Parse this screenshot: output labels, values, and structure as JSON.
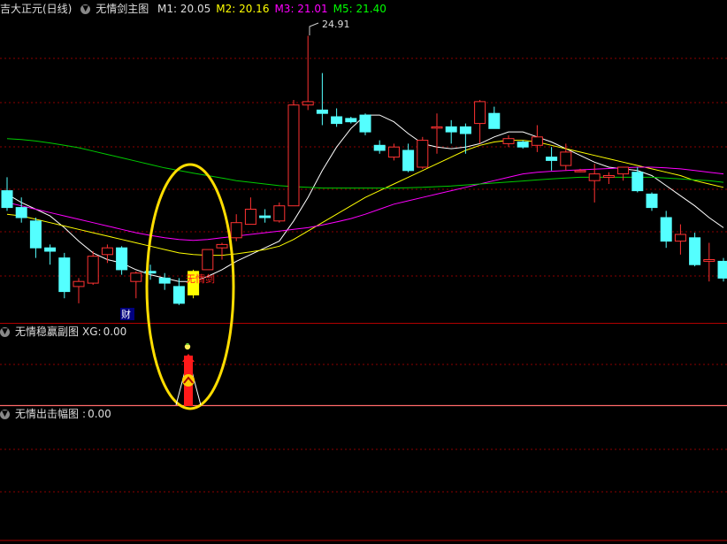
{
  "main_panel": {
    "stock_name": "吉大正元(日线)",
    "indicator_name": "无情剑主图",
    "indicators": [
      {
        "label": "M1:",
        "value": "20.05",
        "color": "#ffffff"
      },
      {
        "label": "M2:",
        "value": "20.16",
        "color": "#ffff00"
      },
      {
        "label": "M3:",
        "value": "21.01",
        "color": "#ff00ff"
      },
      {
        "label": "M5:",
        "value": "21.40",
        "color": "#00ff00"
      }
    ],
    "high_marker": "24.91",
    "signal_label": "无情剑",
    "badge": "财"
  },
  "sub_panel_1": {
    "name": "无情稳赢副图",
    "label": "XG:",
    "value": "0.00"
  },
  "sub_panel_2": {
    "name": "无情出击幅图",
    "label": ":",
    "value": "0.00"
  },
  "icons": [
    "collapse-triangle-icon",
    "up-chevron-signal-icon",
    "bell-icon"
  ],
  "colors": {
    "up_candle": "#ff3232",
    "down_candle": "#54ffff",
    "signal_candle": "#ffff00",
    "ma_m1": "#ffffff",
    "ma_m2": "#ffff00",
    "ma_m3": "#ff00ff",
    "ma_m5": "#00cc00",
    "highlight_ellipse": "#ffdd00",
    "grid": "#8b0000"
  },
  "chart_data": {
    "type": "candlestick",
    "candles": [
      {
        "o": 20.3,
        "h": 20.7,
        "l": 19.7,
        "c": 19.8
      },
      {
        "o": 19.8,
        "h": 20.1,
        "l": 19.35,
        "c": 19.5
      },
      {
        "o": 19.4,
        "h": 19.5,
        "l": 18.3,
        "c": 18.6
      },
      {
        "o": 18.6,
        "h": 18.7,
        "l": 18.1,
        "c": 18.5
      },
      {
        "o": 18.3,
        "h": 18.45,
        "l": 17.1,
        "c": 17.3
      },
      {
        "o": 17.45,
        "h": 17.7,
        "l": 16.95,
        "c": 17.6
      },
      {
        "o": 17.55,
        "h": 18.5,
        "l": 17.5,
        "c": 18.35
      },
      {
        "o": 18.4,
        "h": 18.7,
        "l": 18.15,
        "c": 18.6
      },
      {
        "o": 18.6,
        "h": 18.65,
        "l": 17.8,
        "c": 17.95
      },
      {
        "o": 17.6,
        "h": 17.9,
        "l": 17.1,
        "c": 17.85
      },
      {
        "o": 17.9,
        "h": 18.1,
        "l": 17.65,
        "c": 17.85
      },
      {
        "o": 17.7,
        "h": 17.85,
        "l": 17.35,
        "c": 17.55
      },
      {
        "o": 17.45,
        "h": 17.7,
        "l": 16.9,
        "c": 16.95
      },
      {
        "o": 17.2,
        "h": 17.95,
        "l": 17.1,
        "c": 17.9,
        "signal": true
      },
      {
        "o": 17.95,
        "h": 18.55,
        "l": 17.95,
        "c": 18.55
      },
      {
        "o": 18.6,
        "h": 18.75,
        "l": 18.25,
        "c": 18.7
      },
      {
        "o": 18.9,
        "h": 19.6,
        "l": 18.8,
        "c": 19.35
      },
      {
        "o": 19.3,
        "h": 20.1,
        "l": 19.3,
        "c": 19.75
      },
      {
        "o": 19.55,
        "h": 19.75,
        "l": 19.35,
        "c": 19.5
      },
      {
        "o": 19.4,
        "h": 19.95,
        "l": 19.35,
        "c": 19.85
      },
      {
        "o": 19.85,
        "h": 23.0,
        "l": 19.85,
        "c": 22.85
      },
      {
        "o": 22.85,
        "h": 24.91,
        "l": 22.7,
        "c": 22.95
      },
      {
        "o": 22.7,
        "h": 23.8,
        "l": 22.25,
        "c": 22.6
      },
      {
        "o": 22.5,
        "h": 22.75,
        "l": 22.2,
        "c": 22.3
      },
      {
        "o": 22.45,
        "h": 22.5,
        "l": 22.3,
        "c": 22.35
      },
      {
        "o": 22.55,
        "h": 22.6,
        "l": 21.95,
        "c": 22.05
      },
      {
        "o": 21.65,
        "h": 21.8,
        "l": 21.4,
        "c": 21.5
      },
      {
        "o": 21.3,
        "h": 21.7,
        "l": 21.2,
        "c": 21.6
      },
      {
        "o": 21.5,
        "h": 21.7,
        "l": 20.85,
        "c": 20.9
      },
      {
        "o": 21.0,
        "h": 21.9,
        "l": 20.95,
        "c": 21.8
      },
      {
        "o": 22.2,
        "h": 22.6,
        "l": 21.4,
        "c": 22.2
      },
      {
        "o": 22.2,
        "h": 22.4,
        "l": 21.7,
        "c": 22.05
      },
      {
        "o": 22.2,
        "h": 22.3,
        "l": 21.4,
        "c": 22.0
      },
      {
        "o": 22.3,
        "h": 23.0,
        "l": 21.7,
        "c": 22.95
      },
      {
        "o": 22.6,
        "h": 22.8,
        "l": 22.15,
        "c": 22.15
      },
      {
        "o": 21.7,
        "h": 21.95,
        "l": 21.6,
        "c": 21.85
      },
      {
        "o": 21.75,
        "h": 21.8,
        "l": 21.55,
        "c": 21.6
      },
      {
        "o": 21.65,
        "h": 22.25,
        "l": 21.45,
        "c": 21.9
      },
      {
        "o": 21.3,
        "h": 21.6,
        "l": 20.9,
        "c": 21.2
      },
      {
        "o": 21.05,
        "h": 21.7,
        "l": 20.9,
        "c": 21.45
      },
      {
        "o": 20.9,
        "h": 20.95,
        "l": 20.85,
        "c": 20.9
      },
      {
        "o": 20.6,
        "h": 21.1,
        "l": 19.95,
        "c": 20.8
      },
      {
        "o": 20.7,
        "h": 20.85,
        "l": 20.5,
        "c": 20.75
      },
      {
        "o": 20.8,
        "h": 21.0,
        "l": 20.6,
        "c": 21.0
      },
      {
        "o": 20.85,
        "h": 21.0,
        "l": 20.25,
        "c": 20.3
      },
      {
        "o": 20.2,
        "h": 20.25,
        "l": 19.7,
        "c": 19.8
      },
      {
        "o": 19.5,
        "h": 19.7,
        "l": 18.6,
        "c": 18.8
      },
      {
        "o": 18.8,
        "h": 19.3,
        "l": 18.4,
        "c": 19.0
      },
      {
        "o": 18.9,
        "h": 19.05,
        "l": 18.05,
        "c": 18.1
      },
      {
        "o": 18.2,
        "h": 18.75,
        "l": 17.6,
        "c": 18.25
      },
      {
        "o": 18.2,
        "h": 18.3,
        "l": 17.6,
        "c": 17.7
      }
    ],
    "ma_lines": [
      {
        "name": "M1",
        "color": "#ffffff",
        "values": [
          20.2,
          19.95,
          19.75,
          19.55,
          19.2,
          18.8,
          18.45,
          18.25,
          18.15,
          17.95,
          17.8,
          17.7,
          17.6,
          17.6,
          17.75,
          17.95,
          18.2,
          18.4,
          18.6,
          18.8,
          19.4,
          20.1,
          20.9,
          21.6,
          22.15,
          22.55,
          22.55,
          22.35,
          22.0,
          21.7,
          21.6,
          21.55,
          21.6,
          21.7,
          21.9,
          22.05,
          22.05,
          21.9,
          21.75,
          21.55,
          21.35,
          21.15,
          21.0,
          20.95,
          20.9,
          20.75,
          20.45,
          20.15,
          19.85,
          19.5,
          19.2
        ]
      },
      {
        "name": "M2",
        "color": "#ffff00",
        "values": [
          19.6,
          19.55,
          19.45,
          19.35,
          19.25,
          19.15,
          19.05,
          18.95,
          18.85,
          18.75,
          18.65,
          18.55,
          18.45,
          18.4,
          18.38,
          18.38,
          18.42,
          18.48,
          18.55,
          18.65,
          18.85,
          19.1,
          19.35,
          19.6,
          19.85,
          20.1,
          20.3,
          20.5,
          20.7,
          20.9,
          21.1,
          21.3,
          21.5,
          21.65,
          21.75,
          21.8,
          21.8,
          21.75,
          21.65,
          21.55,
          21.45,
          21.35,
          21.25,
          21.15,
          21.05,
          20.95,
          20.85,
          20.75,
          20.6,
          20.5,
          20.4
        ]
      },
      {
        "name": "M3",
        "color": "#ff00ff",
        "values": [
          19.95,
          19.85,
          19.75,
          19.65,
          19.55,
          19.45,
          19.35,
          19.25,
          19.15,
          19.05,
          18.97,
          18.9,
          18.85,
          18.82,
          18.85,
          18.9,
          18.95,
          19.0,
          19.05,
          19.1,
          19.15,
          19.2,
          19.28,
          19.37,
          19.47,
          19.6,
          19.75,
          19.9,
          20.0,
          20.1,
          20.2,
          20.3,
          20.4,
          20.5,
          20.6,
          20.7,
          20.8,
          20.85,
          20.88,
          20.9,
          20.92,
          20.94,
          20.96,
          20.98,
          21.0,
          21.0,
          20.98,
          20.95,
          20.9,
          20.85,
          20.8
        ]
      },
      {
        "name": "M5",
        "color": "#00cc00",
        "values": [
          21.85,
          21.82,
          21.78,
          21.72,
          21.65,
          21.58,
          21.48,
          21.38,
          21.28,
          21.18,
          21.08,
          20.98,
          20.9,
          20.82,
          20.75,
          20.68,
          20.6,
          20.55,
          20.5,
          20.45,
          20.42,
          20.4,
          20.38,
          20.38,
          20.38,
          20.38,
          20.38,
          20.38,
          20.39,
          20.4,
          20.42,
          20.44,
          20.47,
          20.5,
          20.53,
          20.56,
          20.59,
          20.62,
          20.65,
          20.68,
          20.7,
          20.7,
          20.7,
          20.7,
          20.7,
          20.7,
          20.68,
          20.65,
          20.62,
          20.6,
          20.55
        ]
      }
    ],
    "signal_index": 13,
    "ylim": [
      16.5,
      25.5
    ]
  }
}
